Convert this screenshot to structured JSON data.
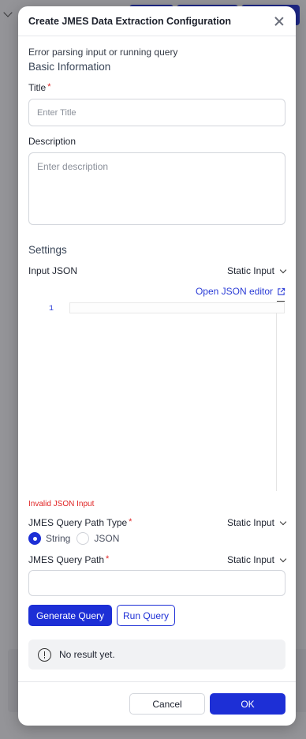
{
  "modal": {
    "title": "Create JMES Data Extraction Configuration",
    "error_message": "Error parsing input or running query"
  },
  "basic_info": {
    "heading": "Basic Information",
    "title_label": "Title",
    "title_placeholder": "Enter Title",
    "title_value": "",
    "description_label": "Description",
    "description_placeholder": "Enter description",
    "description_value": ""
  },
  "settings": {
    "heading": "Settings",
    "input_json_label": "Input JSON",
    "input_json_mode": "Static Input",
    "open_editor_link": "Open JSON editor",
    "editor_line_numbers": [
      "1"
    ],
    "invalid_json_text": "Invalid JSON Input",
    "query_path_type_label": "JMES Query Path Type",
    "query_path_type_mode": "Static Input",
    "query_path_type_options": [
      "String",
      "JSON"
    ],
    "query_path_type_selected": "String",
    "query_path_label": "JMES Query Path",
    "query_path_mode": "Static Input",
    "query_path_value": ""
  },
  "actions": {
    "generate_query": "Generate Query",
    "run_query": "Run Query"
  },
  "result": {
    "text": "No result yet."
  },
  "footer": {
    "cancel": "Cancel",
    "ok": "OK"
  },
  "colors": {
    "accent": "#1d2fd6",
    "error": "#e02424"
  },
  "icons": {
    "close": "close-icon",
    "chevron": "chevron-down-icon",
    "external_link": "external-link-icon",
    "info": "info-icon"
  }
}
